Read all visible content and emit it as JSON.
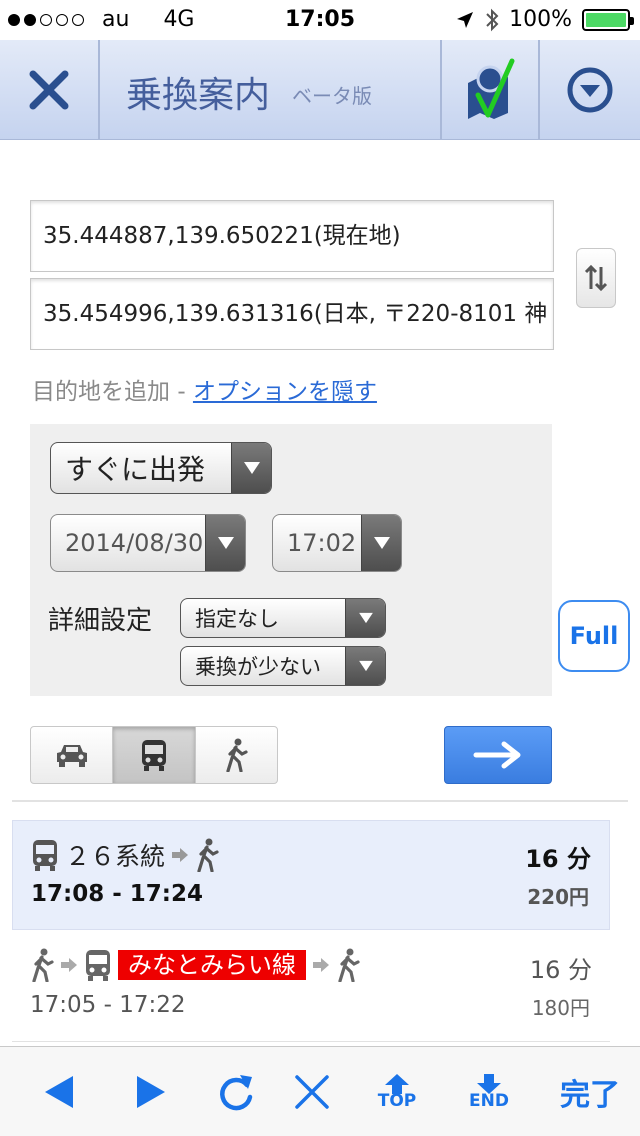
{
  "status_bar": {
    "carrier": "au",
    "network": "4G",
    "time": "17:05",
    "battery": "100%"
  },
  "header": {
    "title": "乗換案内",
    "subtitle": "ベータ版"
  },
  "route": {
    "origin": "35.444887,139.650221(現在地)",
    "destination": "35.454996,139.631316(日本, 〒220-8101 神"
  },
  "options_links": {
    "add_destination": "目的地を追加",
    "separator": "-",
    "hide_options": "オプションを隠す"
  },
  "departure": {
    "mode_value": "すぐに出発",
    "date_value": "2014/08/30",
    "time_value": "17:02"
  },
  "detail": {
    "label": "詳細設定",
    "filter_value": "指定なし",
    "sort_value": "乗換が少ない"
  },
  "full_button": "Full",
  "results": [
    {
      "line_label": "２６系統",
      "times": "17:08 - 17:24",
      "duration": "16 分",
      "fare": "220円"
    },
    {
      "line_label": "みなとみらい線",
      "times": "17:05 - 17:22",
      "duration": "16 分",
      "fare": "180円"
    }
  ],
  "toolbar": {
    "top_label": "TOP",
    "end_label": "END",
    "done_label": "完了"
  },
  "colors": {
    "accent_blue": "#1a73e8",
    "header_bg": "#c5d3ef",
    "line_badge": "#e00000"
  }
}
